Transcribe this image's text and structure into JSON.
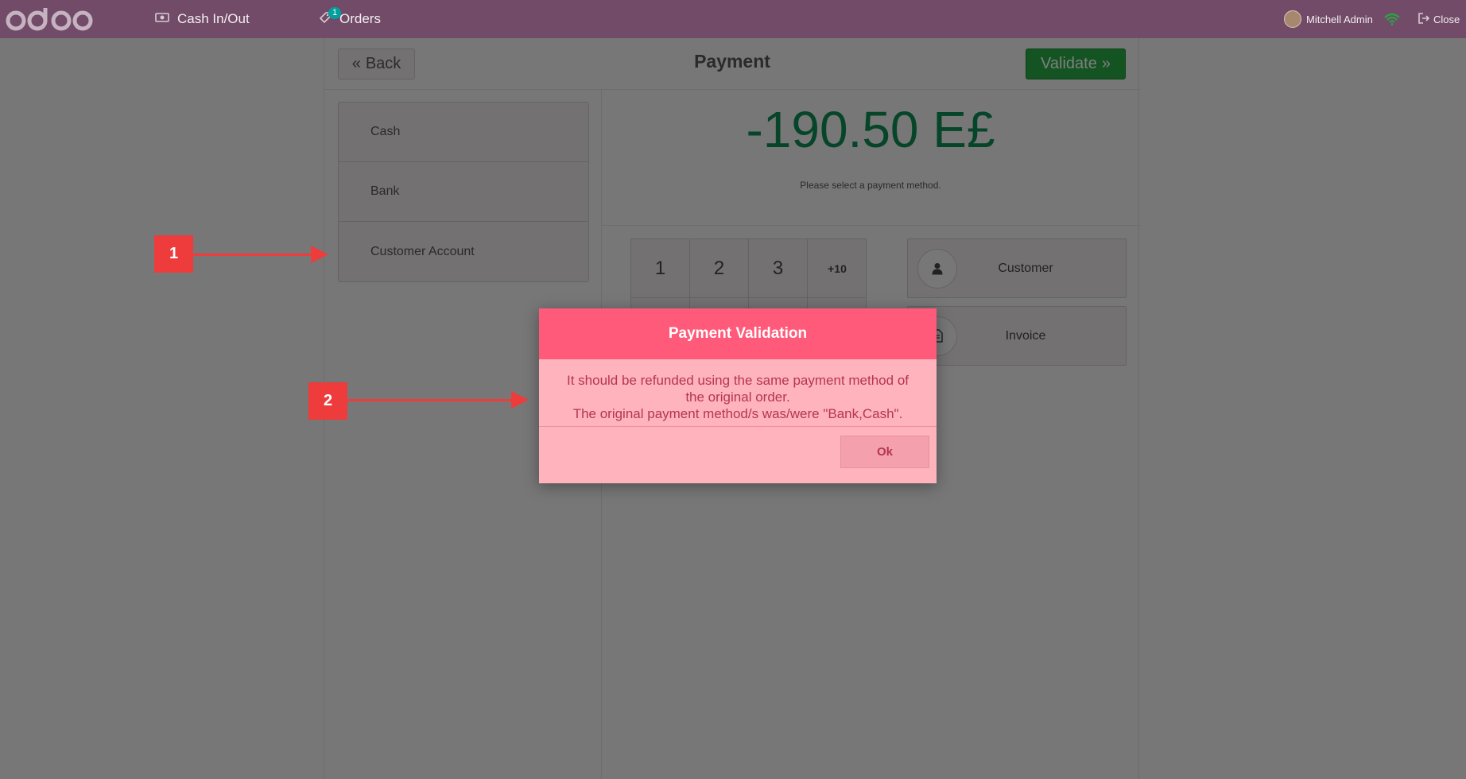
{
  "topbar": {
    "brand": "odoo",
    "cash_label": "Cash In/Out",
    "orders_label": "Orders",
    "orders_badge": "1",
    "user_name": "Mitchell Admin",
    "close_label": "Close"
  },
  "payment": {
    "back_label": "Back",
    "title": "Payment",
    "validate_label": "Validate",
    "methods": [
      "Cash",
      "Bank",
      "Customer Account"
    ],
    "amount": "-190.50 E£",
    "hint": "Please select a payment method.",
    "numpad_keys": [
      "1",
      "2",
      "3",
      "+10",
      "",
      "",
      "",
      ""
    ],
    "customer_label": "Customer",
    "invoice_label": "Invoice"
  },
  "modal": {
    "title": "Payment Validation",
    "line1": "It should be refunded using the same payment method of the original order.",
    "line2": "The original payment method/s was/were \"Bank,Cash\".",
    "ok_label": "Ok"
  },
  "annotations": {
    "marker1": "1",
    "marker2": "2"
  },
  "colors": {
    "topbar": "#714B67",
    "validate": "#28a745",
    "amount": "#0e8a55",
    "modal_header": "#ff5a79",
    "modal_body": "#ffb3bc",
    "annotation": "#ee3b3b"
  }
}
